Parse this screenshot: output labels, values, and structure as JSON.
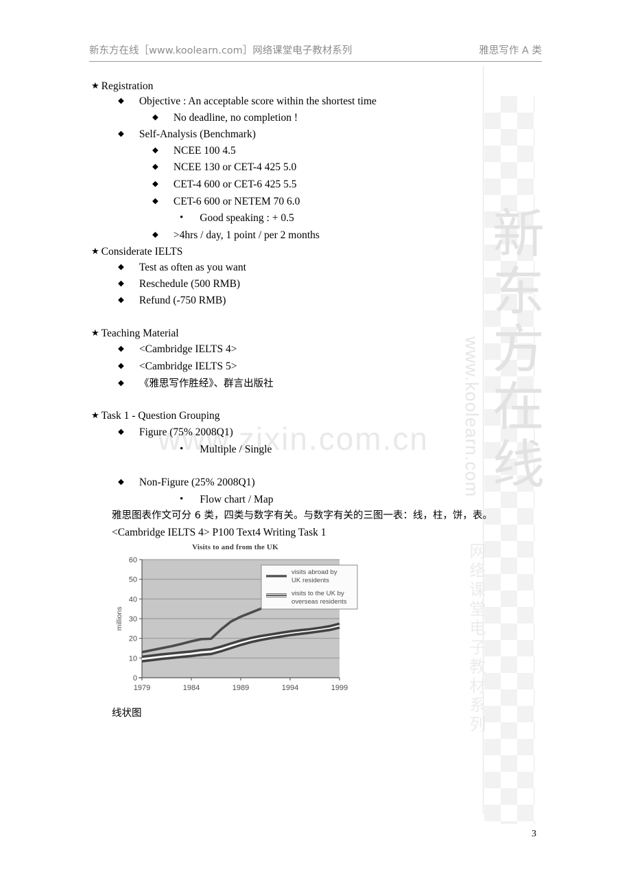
{
  "page": {
    "number": "3",
    "header_left": "新东方在线［www.koolearn.com］网络课堂电子教材系列",
    "header_right": "雅思写作 A 类"
  },
  "watermarks": {
    "vertical_brand": "新东方在线",
    "vertical_url": "www.koolearn.com",
    "vertical_series": "网络课堂电子教材系列",
    "diagonal_site": "www.zixin.com.cn"
  },
  "bullets": {
    "star": "★",
    "diamond": "◆",
    "dot": "•"
  },
  "outline": [
    {
      "level": 1,
      "text": "Registration"
    },
    {
      "level": 2,
      "text": "Objective : An acceptable score within the shortest time"
    },
    {
      "level": 3,
      "text": "No deadline, no completion !"
    },
    {
      "level": 2,
      "text": "Self-Analysis (Benchmark)"
    },
    {
      "level": 3,
      "text": "NCEE  100                                    4.5"
    },
    {
      "level": 3,
      "text": "NCEE  130  or     CET-4    425  5.0"
    },
    {
      "level": 3,
      "text": "CET-4  600  or     CET-6    425         5.5"
    },
    {
      "level": 3,
      "text": "CET-6  600  or     NETEM  70    6.0"
    },
    {
      "level": 4,
      "text": "Good speaking : + 0.5"
    },
    {
      "level": 3,
      "text": ">4hrs / day, 1 point / per 2 months"
    },
    {
      "level": 1,
      "text": "Considerate IELTS"
    },
    {
      "level": 2,
      "text": "Test as often as you want"
    },
    {
      "level": 2,
      "text": "Reschedule (500 RMB)"
    },
    {
      "level": 2,
      "text": "Refund (-750 RMB)"
    },
    {
      "level": 1,
      "text": "Teaching Material"
    },
    {
      "level": 2,
      "text": "<Cambridge IELTS 4>"
    },
    {
      "level": 2,
      "text": "<Cambridge IELTS 5>"
    },
    {
      "level": 2,
      "text": "《雅思写作胜经》、群言出版社"
    },
    {
      "level": 1,
      "text": "Task 1 - Question Grouping"
    },
    {
      "level": 2,
      "text": "Figure (75% 2008Q1)"
    },
    {
      "level": 4,
      "text": "Multiple / Single"
    },
    {
      "level": 2,
      "text": "Non-Figure (25% 2008Q1)"
    },
    {
      "level": 4,
      "text": "Flow chart / Map"
    }
  ],
  "notes": {
    "chinese_line": "雅思图表作文可分 6 类，四类与数字有关。与数字有关的三图一表：线，柱，饼，表。",
    "source_line": "<Cambridge IELTS 4> P100    Text4    Writing Task 1",
    "caption": "线状图"
  },
  "chart_data": {
    "type": "line",
    "title": "Visits to and from the UK",
    "xlabel": "",
    "ylabel": "millions",
    "x": [
      1979,
      1980,
      1981,
      1982,
      1983,
      1984,
      1985,
      1986,
      1987,
      1988,
      1989,
      1990,
      1991,
      1992,
      1993,
      1994,
      1995,
      1996,
      1997,
      1998,
      1999
    ],
    "xticks": [
      "1979",
      "1984",
      "1989",
      "1994",
      "1999"
    ],
    "yticks": [
      "0",
      "10",
      "20",
      "30",
      "40",
      "50",
      "60"
    ],
    "ylim": [
      0,
      60
    ],
    "xlim": [
      1979,
      1999
    ],
    "grid": true,
    "legend_position": "right",
    "plot_background": "#c9c9c9",
    "series": [
      {
        "name": "visits abroad by UK residents",
        "style": "single-thick",
        "color": "#4a4a4a",
        "values": [
          13.0,
          14.0,
          15.0,
          16.0,
          17.2,
          18.5,
          19.6,
          19.8,
          24.5,
          28.5,
          31.0,
          33.0,
          35.0,
          37.0,
          39.2,
          41.5,
          44.0,
          46.5,
          49.0,
          51.0,
          53.5
        ]
      },
      {
        "name": "visits to the UK by overseas residents",
        "style": "triple-line",
        "color": "#3f3f3f",
        "values": [
          10.5,
          11.1,
          11.7,
          12.2,
          12.7,
          13.2,
          13.9,
          14.3,
          15.6,
          17.2,
          18.7,
          20.0,
          21.0,
          21.8,
          22.6,
          23.4,
          24.0,
          24.5,
          25.2,
          26.0,
          27.3
        ]
      },
      {
        "name": "visits to the UK by overseas residents (lower edge)",
        "style": "triple-line-lower",
        "color": "#3f3f3f",
        "values": [
          8.5,
          9.1,
          9.7,
          10.2,
          10.7,
          11.2,
          11.8,
          12.2,
          13.6,
          15.2,
          16.8,
          18.2,
          19.3,
          20.2,
          21.0,
          21.8,
          22.4,
          23.0,
          23.7,
          24.4,
          25.6
        ]
      }
    ],
    "legend": [
      {
        "label_line1": "visits abroad by",
        "label_line2": "UK residents",
        "style": "single-thick"
      },
      {
        "label_line1": "visits to the UK by",
        "label_line2": "overseas residents",
        "style": "triple-line"
      }
    ]
  }
}
